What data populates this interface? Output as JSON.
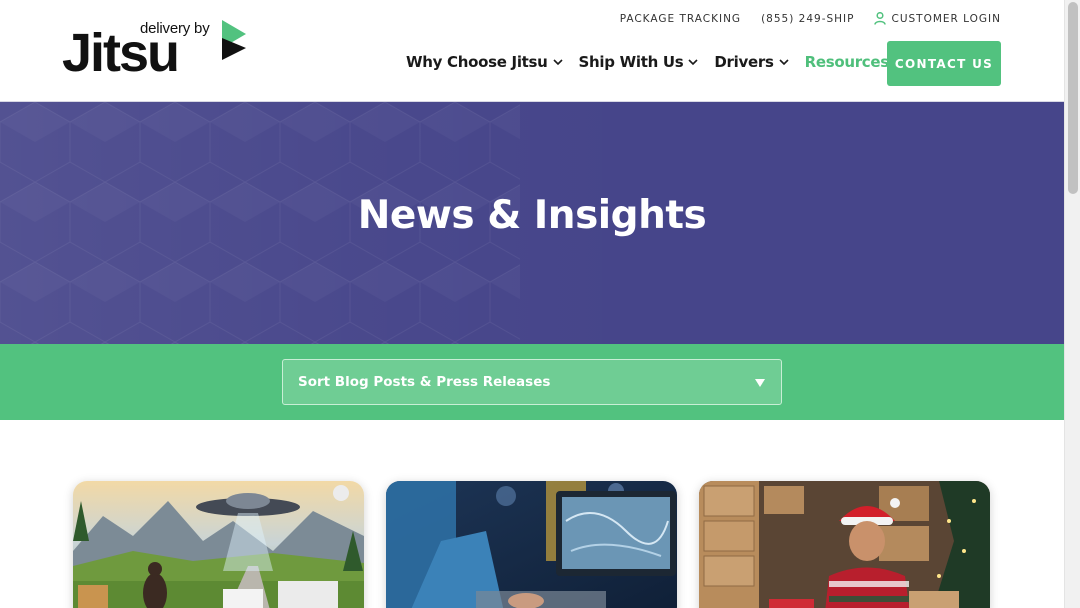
{
  "brand": {
    "tagline": "delivery by",
    "name": "Jitsu",
    "accent_color": "#52c27f",
    "hero_color": "#46458a"
  },
  "utility_nav": {
    "tracking": "PACKAGE TRACKING",
    "phone": "(855) 249-SHIP",
    "login": "CUSTOMER LOGIN"
  },
  "main_nav": {
    "items": [
      {
        "label": "Why Choose Jitsu",
        "icon": "chevron-down-icon"
      },
      {
        "label": "Ship With Us",
        "icon": "chevron-down-icon"
      },
      {
        "label": "Drivers",
        "icon": "chevron-down-icon"
      },
      {
        "label": "Resources",
        "icon": "chevron-down-icon",
        "active": true
      }
    ],
    "cta": "CONTACT US"
  },
  "hero": {
    "title": "News & Insights"
  },
  "sort": {
    "label": "Sort Blog Posts & Press Releases"
  },
  "cards": [
    {
      "image": "ufo-sasquatch-delivery-illustration"
    },
    {
      "image": "person-at-computer-monitor-map"
    },
    {
      "image": "man-in-santa-hat-with-packages"
    }
  ]
}
